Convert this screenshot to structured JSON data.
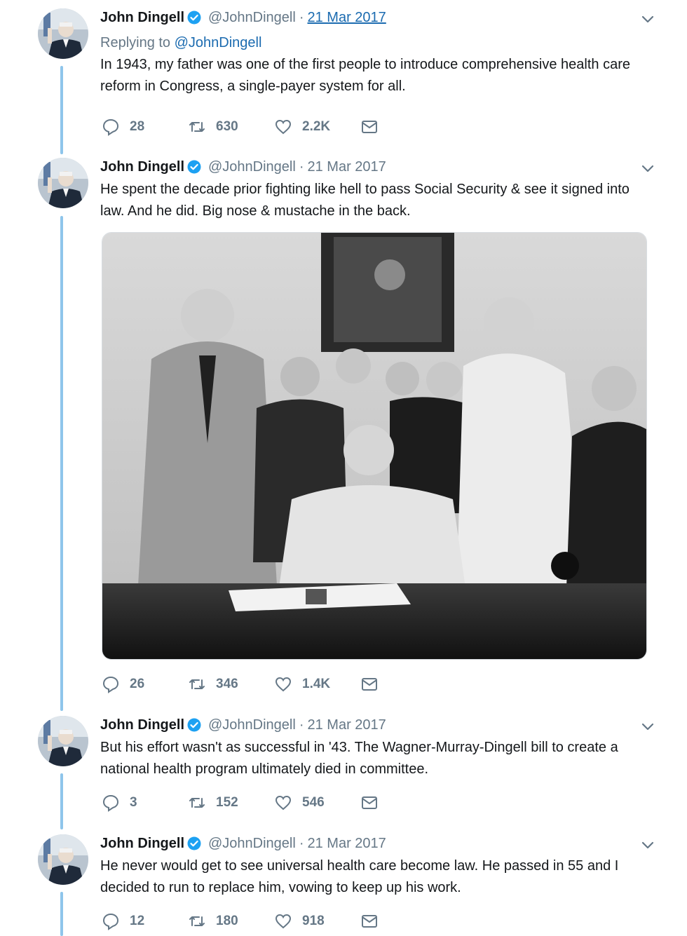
{
  "author": {
    "name": "John Dingell",
    "handle": "@JohnDingell",
    "verified": true,
    "avatar_icon": "profile-photo-avatar"
  },
  "colors": {
    "thread_line": "#8ec5eb",
    "link": "#1b6bb0",
    "muted": "#657786",
    "verified": "#1da1f2"
  },
  "tweets": [
    {
      "date": "21 Mar 2017",
      "replying_to_label": "Replying to",
      "replying_to_handle": "@JohnDingell",
      "text": "In 1943, my father was one of the first people to introduce comprehensive health care reform in Congress, a single-payer system for all.",
      "replies": "28",
      "retweets": "630",
      "likes": "2.2K"
    },
    {
      "date": "21 Mar 2017",
      "text": "He spent the decade prior fighting like hell to pass Social Security & see it signed into law. And he did. Big nose & mustache in the back.",
      "media": "black-and-white-photo-of-president-signing-bill",
      "replies": "26",
      "retweets": "346",
      "likes": "1.4K"
    },
    {
      "date": "21 Mar 2017",
      "text": "But his effort wasn't as successful in '43. The Wagner-Murray-Dingell bill to create a national health program ultimately died in committee.",
      "replies": "3",
      "retweets": "152",
      "likes": "546"
    },
    {
      "date": "21 Mar 2017",
      "text": "He never would get to see universal health care become law. He passed in 55 and I decided to run to replace him, vowing to keep up his work.",
      "replies": "12",
      "retweets": "180",
      "likes": "918"
    }
  ],
  "header": {
    "separator": "·"
  }
}
